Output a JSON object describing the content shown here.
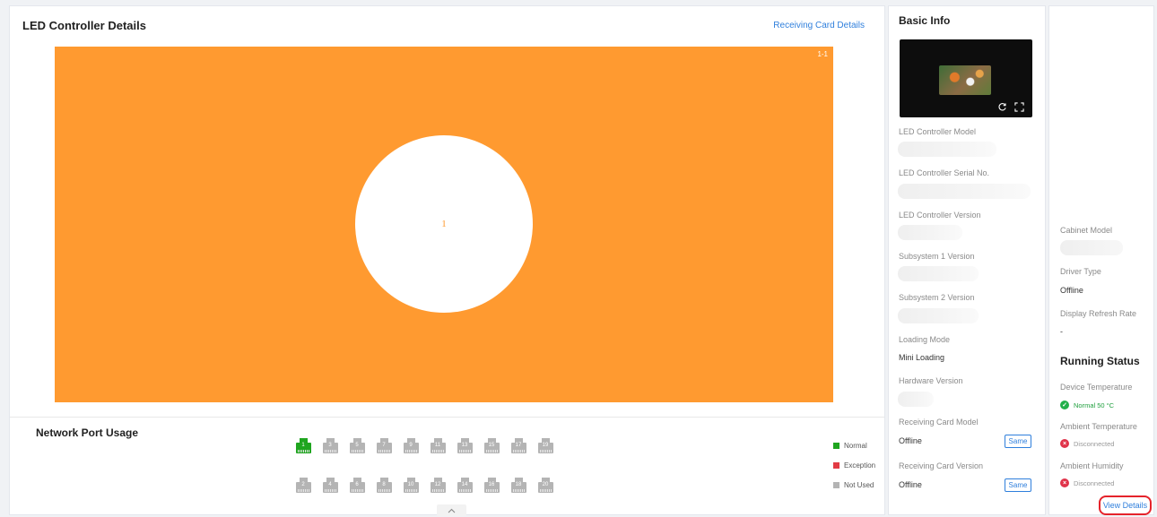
{
  "left": {
    "title": "LED Controller Details",
    "receiving_card_link": "Receiving Card Details",
    "screen_tag": "1-1",
    "screen_number": "1",
    "network_port_title": "Network Port Usage",
    "ports_top": [
      {
        "num": "1",
        "status": "normal"
      },
      {
        "num": "3",
        "status": "not-used"
      },
      {
        "num": "5",
        "status": "not-used"
      },
      {
        "num": "7",
        "status": "not-used"
      },
      {
        "num": "9",
        "status": "not-used"
      },
      {
        "num": "11",
        "status": "not-used"
      },
      {
        "num": "13",
        "status": "not-used"
      },
      {
        "num": "15",
        "status": "not-used"
      },
      {
        "num": "17",
        "status": "not-used"
      },
      {
        "num": "19",
        "status": "not-used"
      }
    ],
    "ports_bottom": [
      {
        "num": "2",
        "status": "not-used"
      },
      {
        "num": "4",
        "status": "not-used"
      },
      {
        "num": "6",
        "status": "not-used"
      },
      {
        "num": "8",
        "status": "not-used"
      },
      {
        "num": "10",
        "status": "not-used"
      },
      {
        "num": "12",
        "status": "not-used"
      },
      {
        "num": "14",
        "status": "not-used"
      },
      {
        "num": "16",
        "status": "not-used"
      },
      {
        "num": "18",
        "status": "not-used"
      },
      {
        "num": "20",
        "status": "not-used"
      }
    ],
    "legend": {
      "normal": "Normal",
      "exception": "Exception",
      "not_used": "Not Used"
    },
    "colors": {
      "screen": "#ff9a30",
      "normal": "#1fa51f",
      "exception": "#e23b44",
      "not_used": "#b4b4b4"
    }
  },
  "basic": {
    "title": "Basic Info",
    "model_label": "LED Controller Model",
    "serial_label": "LED Controller Serial No.",
    "version_label": "LED Controller Version",
    "subsystem1_label": "Subsystem 1 Version",
    "subsystem2_label": "Subsystem 2 Version",
    "loading_mode_label": "Loading Mode",
    "loading_mode_value": "Mini Loading",
    "hardware_label": "Hardware Version",
    "rc_model_label": "Receiving Card Model",
    "rc_model_value": "Offline",
    "rc_version_label": "Receiving Card Version",
    "rc_version_value": "Offline",
    "same_label": "Same"
  },
  "right": {
    "cabinet_model_label": "Cabinet Model",
    "driver_type_label": "Driver Type",
    "driver_type_value": "Offline",
    "refresh_label": "Display Refresh Rate",
    "refresh_value": "-",
    "running_status_title": "Running Status",
    "device_temp_label": "Device Temperature",
    "device_temp_value": "Normal 50 °C",
    "ambient_temp_label": "Ambient Temperature",
    "ambient_temp_value": "Disconnected",
    "ambient_humidity_label": "Ambient Humidity",
    "ambient_humidity_value": "Disconnected",
    "view_details": "View Details"
  },
  "icons": {
    "refresh": "refresh-icon",
    "fullscreen": "fullscreen-icon",
    "collapse": "chevron-up-icon",
    "ok": "check-circle-icon",
    "error": "x-circle-icon"
  }
}
